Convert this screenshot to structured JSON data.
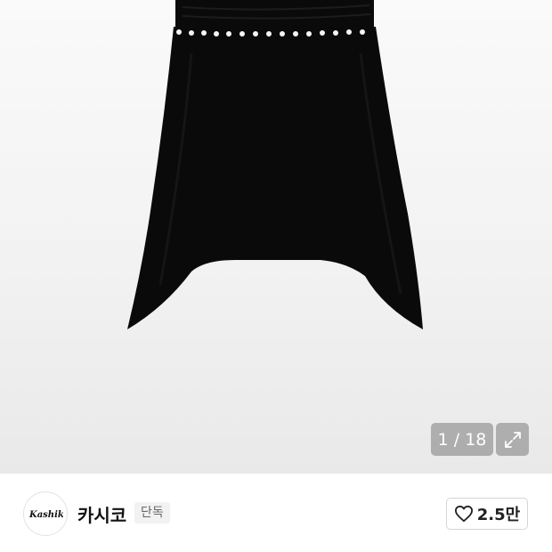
{
  "gallery": {
    "current_index": "1",
    "total": "18",
    "counter_text": "1 / 18",
    "expand_icon": "expand-icon"
  },
  "shop": {
    "logo_text": "Kashiko",
    "name": "카시코",
    "badge": "단독"
  },
  "like": {
    "icon": "heart-outline-icon",
    "count": "2.5만"
  },
  "colors": {
    "skirt": "#0a0a0a",
    "studs": "#f5f5f5",
    "overlay": "#969696",
    "background": "#ffffff"
  }
}
